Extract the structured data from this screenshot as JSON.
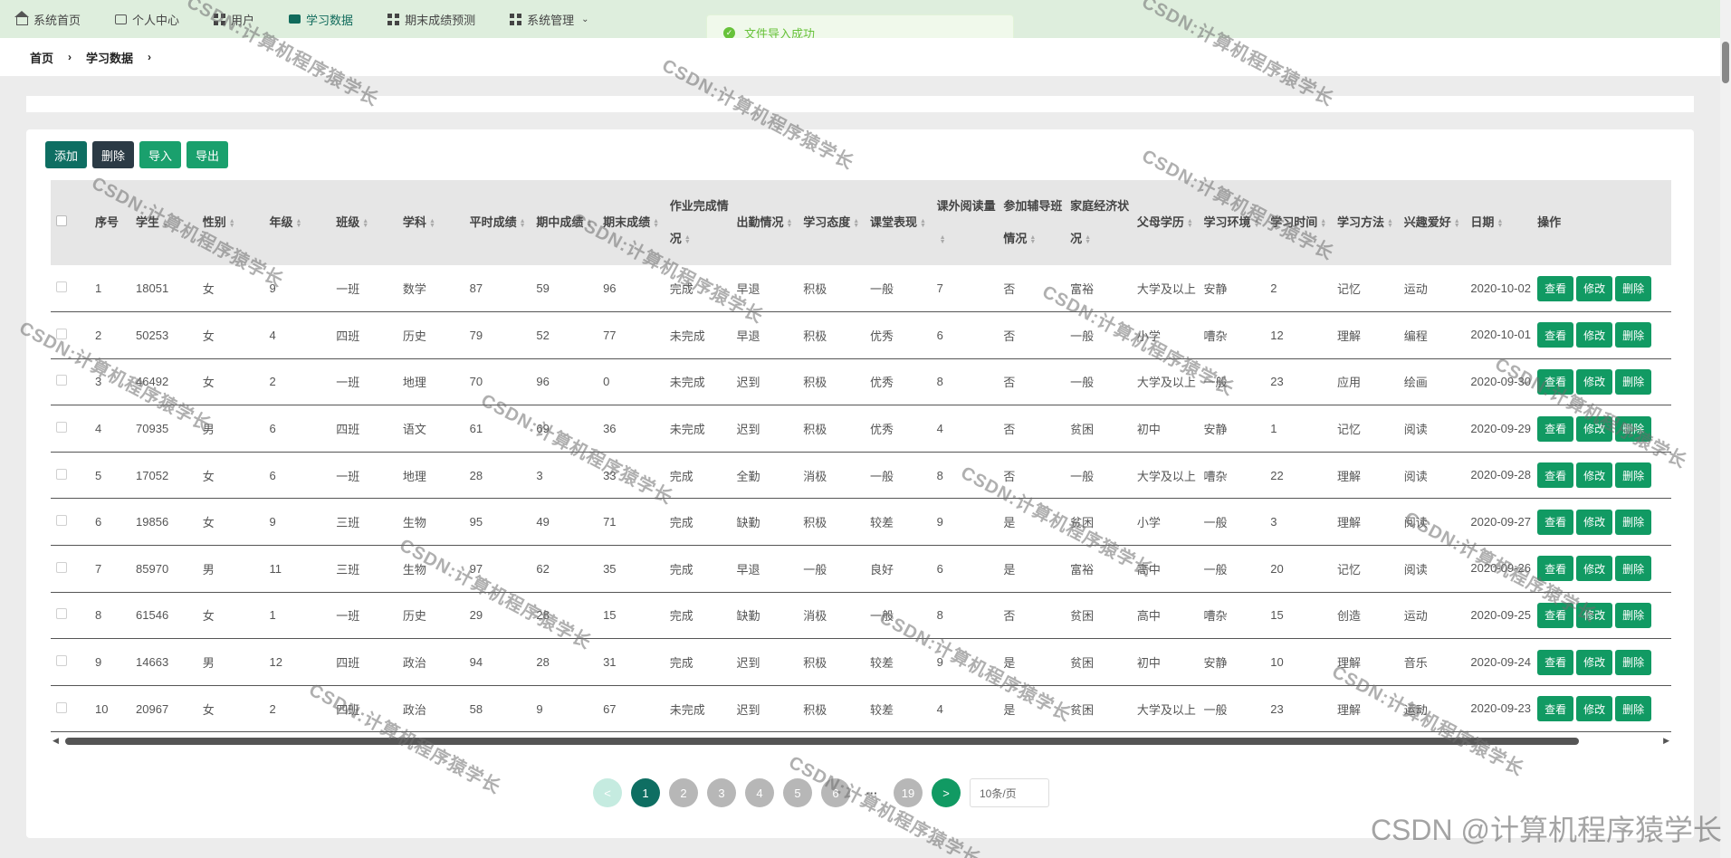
{
  "nav": [
    {
      "label": "系统首页",
      "icon": "home-icon"
    },
    {
      "label": "个人中心",
      "icon": "user-card-icon"
    },
    {
      "label": "用户",
      "icon": "grid-icon"
    },
    {
      "label": "学习数据",
      "icon": "chat-icon",
      "active": true
    },
    {
      "label": "期末成绩预测",
      "icon": "grid-icon"
    },
    {
      "label": "系统管理",
      "icon": "grid-icon",
      "has_dropdown": true
    }
  ],
  "toast": {
    "text": "文件导入成功"
  },
  "breadcrumb": [
    "首页",
    "学习数据"
  ],
  "toolbar": {
    "add": "添加",
    "delete": "删除",
    "import": "导入",
    "export": "导出"
  },
  "table": {
    "headers": [
      "序号",
      "学生",
      "性别",
      "年级",
      "班级",
      "学科",
      "平时成绩",
      "期中成绩",
      "期末成绩",
      "作业完成情况",
      "出勤情况",
      "学习态度",
      "课堂表现",
      "课外阅读量",
      "参加辅导班情况",
      "家庭经济状况",
      "父母学历",
      "学习环境",
      "学习时间",
      "学习方法",
      "兴趣爱好",
      "日期",
      "操作"
    ],
    "row_actions": {
      "view": "查看",
      "edit": "修改",
      "delete": "删除"
    },
    "rows": [
      [
        "1",
        "18051",
        "女",
        "9",
        "一班",
        "数学",
        "87",
        "59",
        "96",
        "完成",
        "早退",
        "积极",
        "一般",
        "7",
        "否",
        "富裕",
        "大学及以上",
        "安静",
        "2",
        "记忆",
        "运动",
        "2020-10-02"
      ],
      [
        "2",
        "50253",
        "女",
        "4",
        "四班",
        "历史",
        "79",
        "52",
        "77",
        "未完成",
        "早退",
        "积极",
        "优秀",
        "6",
        "否",
        "一般",
        "小学",
        "嘈杂",
        "12",
        "理解",
        "编程",
        "2020-10-01"
      ],
      [
        "3",
        "46492",
        "女",
        "2",
        "一班",
        "地理",
        "70",
        "96",
        "0",
        "未完成",
        "迟到",
        "积极",
        "优秀",
        "8",
        "否",
        "一般",
        "大学及以上",
        "一般",
        "23",
        "应用",
        "绘画",
        "2020-09-30"
      ],
      [
        "4",
        "70935",
        "男",
        "6",
        "四班",
        "语文",
        "61",
        "69",
        "36",
        "未完成",
        "迟到",
        "积极",
        "优秀",
        "4",
        "否",
        "贫困",
        "初中",
        "安静",
        "1",
        "记忆",
        "阅读",
        "2020-09-29"
      ],
      [
        "5",
        "17052",
        "女",
        "6",
        "一班",
        "地理",
        "28",
        "3",
        "33",
        "完成",
        "全勤",
        "消极",
        "一般",
        "8",
        "否",
        "一般",
        "大学及以上",
        "嘈杂",
        "22",
        "理解",
        "阅读",
        "2020-09-28"
      ],
      [
        "6",
        "19856",
        "女",
        "9",
        "三班",
        "生物",
        "95",
        "49",
        "71",
        "完成",
        "缺勤",
        "积极",
        "较差",
        "9",
        "是",
        "贫困",
        "小学",
        "一般",
        "3",
        "理解",
        "阅读",
        "2020-09-27"
      ],
      [
        "7",
        "85970",
        "男",
        "11",
        "三班",
        "生物",
        "97",
        "62",
        "35",
        "完成",
        "早退",
        "一般",
        "良好",
        "6",
        "是",
        "富裕",
        "高中",
        "一般",
        "20",
        "记忆",
        "阅读",
        "2020-09-26"
      ],
      [
        "8",
        "61546",
        "女",
        "1",
        "一班",
        "历史",
        "29",
        "28",
        "15",
        "完成",
        "缺勤",
        "消极",
        "一般",
        "8",
        "否",
        "贫困",
        "高中",
        "嘈杂",
        "15",
        "创造",
        "运动",
        "2020-09-25"
      ],
      [
        "9",
        "14663",
        "男",
        "12",
        "四班",
        "政治",
        "94",
        "28",
        "31",
        "完成",
        "迟到",
        "积极",
        "较差",
        "9",
        "是",
        "贫困",
        "初中",
        "安静",
        "10",
        "理解",
        "音乐",
        "2020-09-24"
      ],
      [
        "10",
        "20967",
        "女",
        "2",
        "四班",
        "政治",
        "58",
        "9",
        "67",
        "未完成",
        "迟到",
        "积极",
        "较差",
        "4",
        "是",
        "贫困",
        "大学及以上",
        "一般",
        "23",
        "理解",
        "运动",
        "2020-09-23"
      ]
    ]
  },
  "pagination": {
    "prev": "<",
    "pages": [
      "1",
      "2",
      "3",
      "4",
      "5",
      "6"
    ],
    "ellipsis": "···",
    "last": "19",
    "next": ">",
    "current": "1",
    "page_size": "10条/页"
  },
  "watermark": "CSDN:计算机程序猿学长",
  "credit": "CSDN @计算机程序猿学长"
}
